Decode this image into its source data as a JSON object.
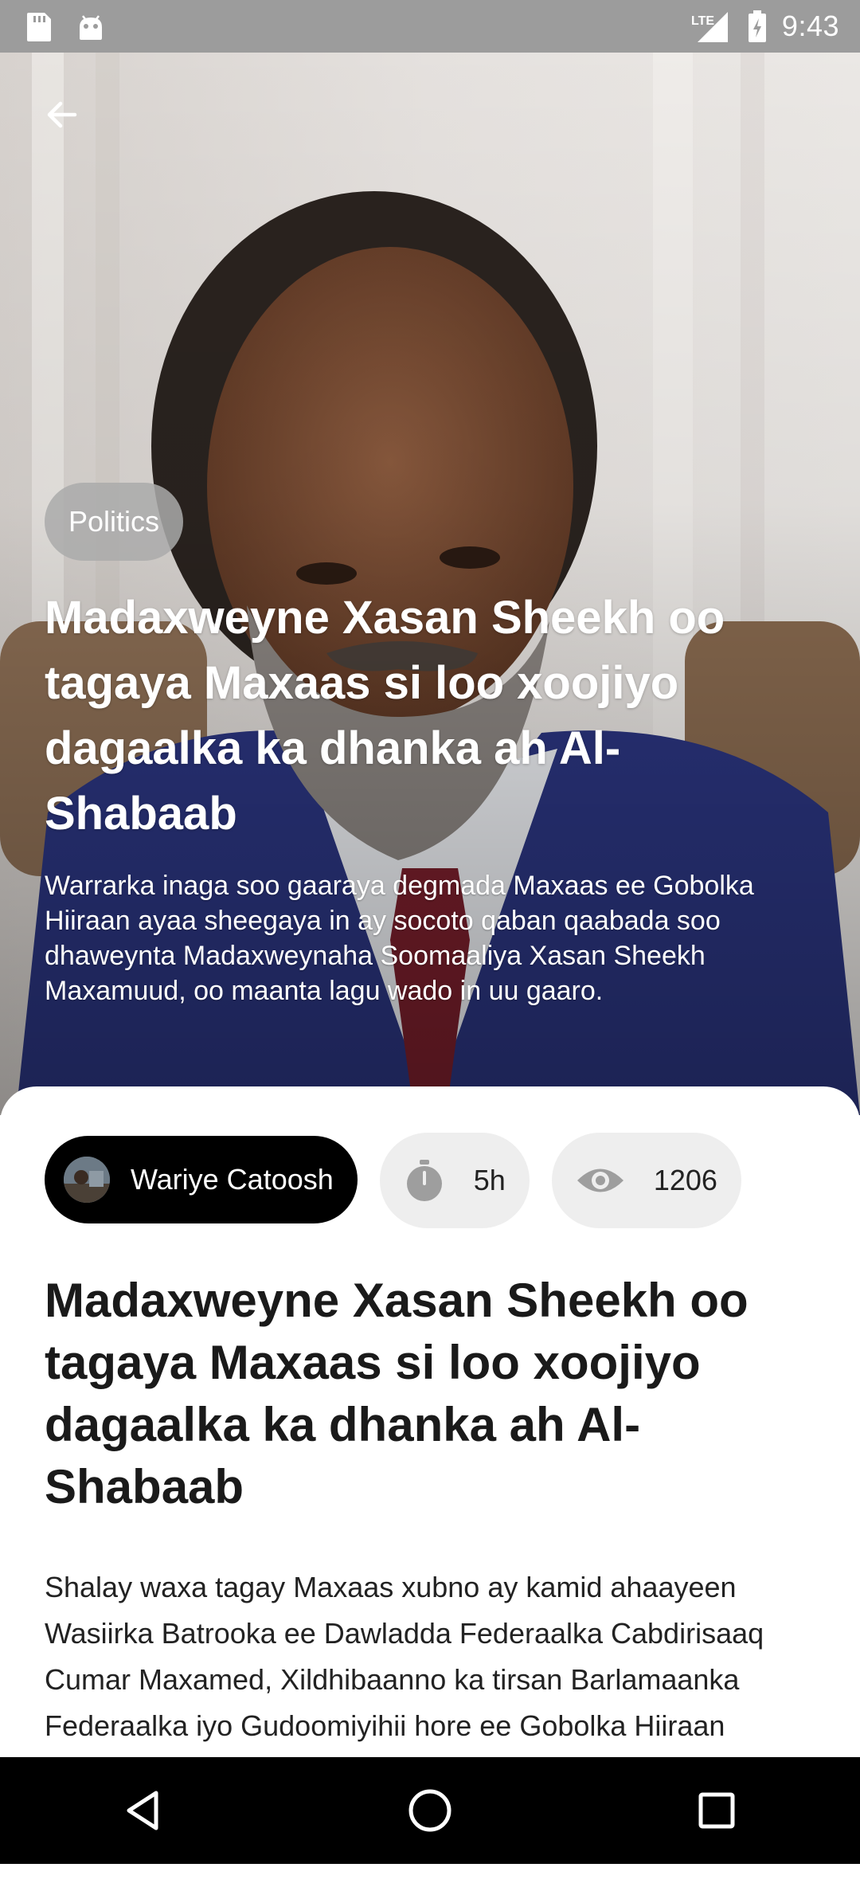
{
  "status_bar": {
    "time": "9:43",
    "network": "LTE",
    "icons": [
      "sd-card-icon",
      "android-icon",
      "lte-signal-icon",
      "battery-charging-icon"
    ]
  },
  "article": {
    "category": "Politics",
    "title": "Madaxweyne Xasan Sheekh oo tagaya Maxaas si loo xoojiyo dagaalka ka dhanka ah Al-Shabaab",
    "summary": "Warrarka inaga soo gaaraya degmada Maxaas ee Gobolka Hiiraan ayaa sheegaya in ay socoto qaban qaabada soo dhaweynta Madaxweynaha Soomaaliya Xasan Sheekh Maxamuud, oo maanta lagu wado in uu gaaro.",
    "author": "Wariye Catoosh",
    "time_ago": "5h",
    "views": "1206",
    "body": "Shalay waxa tagay Maxaas xubno ay kamid ahaayeen Wasiirka Batrooka ee Dawladda Federaalka Cabdirisaaq Cumar Maxamed, Xildhibaanno ka tirsan Barlamaanka Federaalka iyo Gudoomiyihii hore ee Gobolka Hiiraan"
  },
  "icons": {
    "back": "arrow-back-icon",
    "timer": "stopwatch-icon",
    "views": "eye-icon",
    "nav": [
      "back-triangle-icon",
      "home-circle-icon",
      "recents-square-icon"
    ]
  },
  "colors": {
    "status_bar": "#9c9c9c",
    "author_chip": "#000000",
    "pill": "#eeeeee",
    "suit": "#2b3580",
    "nav_bar": "#000000"
  }
}
